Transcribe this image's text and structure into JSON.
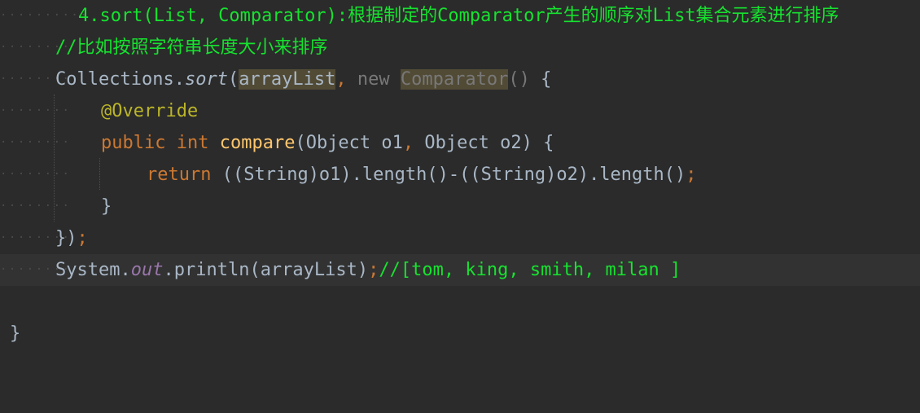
{
  "editor": {
    "background": "#2b2b2b",
    "colors": {
      "comment": "#16e22f",
      "identifier": "#a9b7c6",
      "keyword": "#cc7832",
      "annotation": "#bbb529",
      "method": "#ffc66d",
      "static_field": "#9876aa",
      "muted": "#787878"
    },
    "lines": {
      "l1": {
        "text": "4.sort(List, Comparator):根据制定的Comparator产生的顺序对List集合元素进行排序"
      },
      "l2": {
        "text": "//比如按照字符串长度大小来排序"
      },
      "l3": {
        "class_name": "Collections",
        "dot": ".",
        "method": "sort",
        "paren_open": "(",
        "arg": "arrayList",
        "comma": ",",
        "space": " ",
        "new_kw": "new",
        "type": "Comparator",
        "parens": "()",
        "brace": " {"
      },
      "l4": {
        "annotation": "@Override"
      },
      "l5": {
        "public_kw": "public",
        "int_kw": "int",
        "method": "compare",
        "params_a": "(Object o1",
        "comma": ",",
        "params_b": " Object o2) {"
      },
      "l6": {
        "return_kw": "return",
        "expr": " ((String)o1).length()-((String)o2).length()",
        "semi": ";"
      },
      "l7": {
        "brace": "}"
      },
      "l8": {
        "close": "})",
        "semi": ";"
      },
      "l9": {
        "class_name": "System",
        "dot": ".",
        "field": "out",
        "call": ".println(arrayList)",
        "semi": ";",
        "comment": "//[tom, king, smith, milan ]"
      },
      "l10": {
        "brace": "}"
      }
    }
  }
}
